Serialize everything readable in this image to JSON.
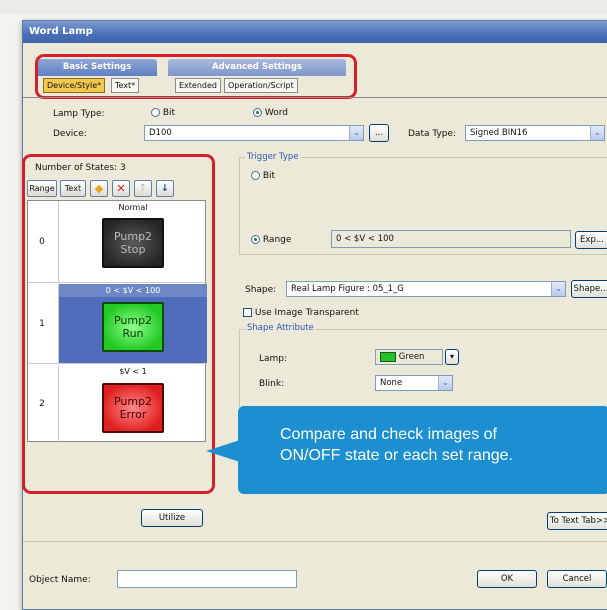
{
  "window": {
    "title": "Word Lamp"
  },
  "tabs": {
    "basic_group": "Basic Settings",
    "advanced_group": "Advanced Settings",
    "sub": [
      "Device/Style*",
      "Text*",
      "Extended",
      "Operation/Script"
    ]
  },
  "lamp_type": {
    "label": "Lamp Type:",
    "bit": "Bit",
    "word": "Word",
    "selected": "Word"
  },
  "device": {
    "label": "Device:",
    "value": "D100",
    "browse": "...",
    "data_type_label": "Data Type:",
    "data_type_value": "Signed BIN16"
  },
  "states": {
    "count_label": "Number of States:",
    "count_value": "3",
    "toolbar": {
      "range": "Range",
      "text": "Text"
    },
    "rows": [
      {
        "num": "0",
        "condition": "Normal",
        "lamp_text": "Pump2\nStop",
        "style": "stop"
      },
      {
        "num": "1",
        "condition": "0 < $V < 100",
        "lamp_text": "Pump2\nRun",
        "style": "run"
      },
      {
        "num": "2",
        "condition": "$V < 1",
        "lamp_text": "Pump2\nError",
        "style": "err"
      }
    ],
    "utilize": "Utilize"
  },
  "trigger": {
    "title": "Trigger Type",
    "bit": "Bit",
    "range": "Range",
    "range_value": "0 < $V < 100",
    "exp": "Exp..."
  },
  "shape": {
    "label": "Shape:",
    "value": "Real Lamp Figure : 05_1_G",
    "button": "Shape..."
  },
  "transparent": {
    "label": "Use Image Transparent"
  },
  "attribute": {
    "title": "Shape Attribute",
    "lamp_label": "Lamp:",
    "lamp_value": "Green",
    "blink_label": "Blink:",
    "blink_value": "None"
  },
  "to_text_tab": "To Text Tab>>",
  "callout": {
    "line1": "Compare and check images of",
    "line2": "ON/OFF state or each set range."
  },
  "footer": {
    "object_name_label": "Object Name:",
    "ok": "OK",
    "cancel": "Cancel"
  },
  "colors": {
    "highlight_outline": "#d5202a",
    "callout": "#1b8fcf",
    "selected_row": "#4f6dbb"
  }
}
